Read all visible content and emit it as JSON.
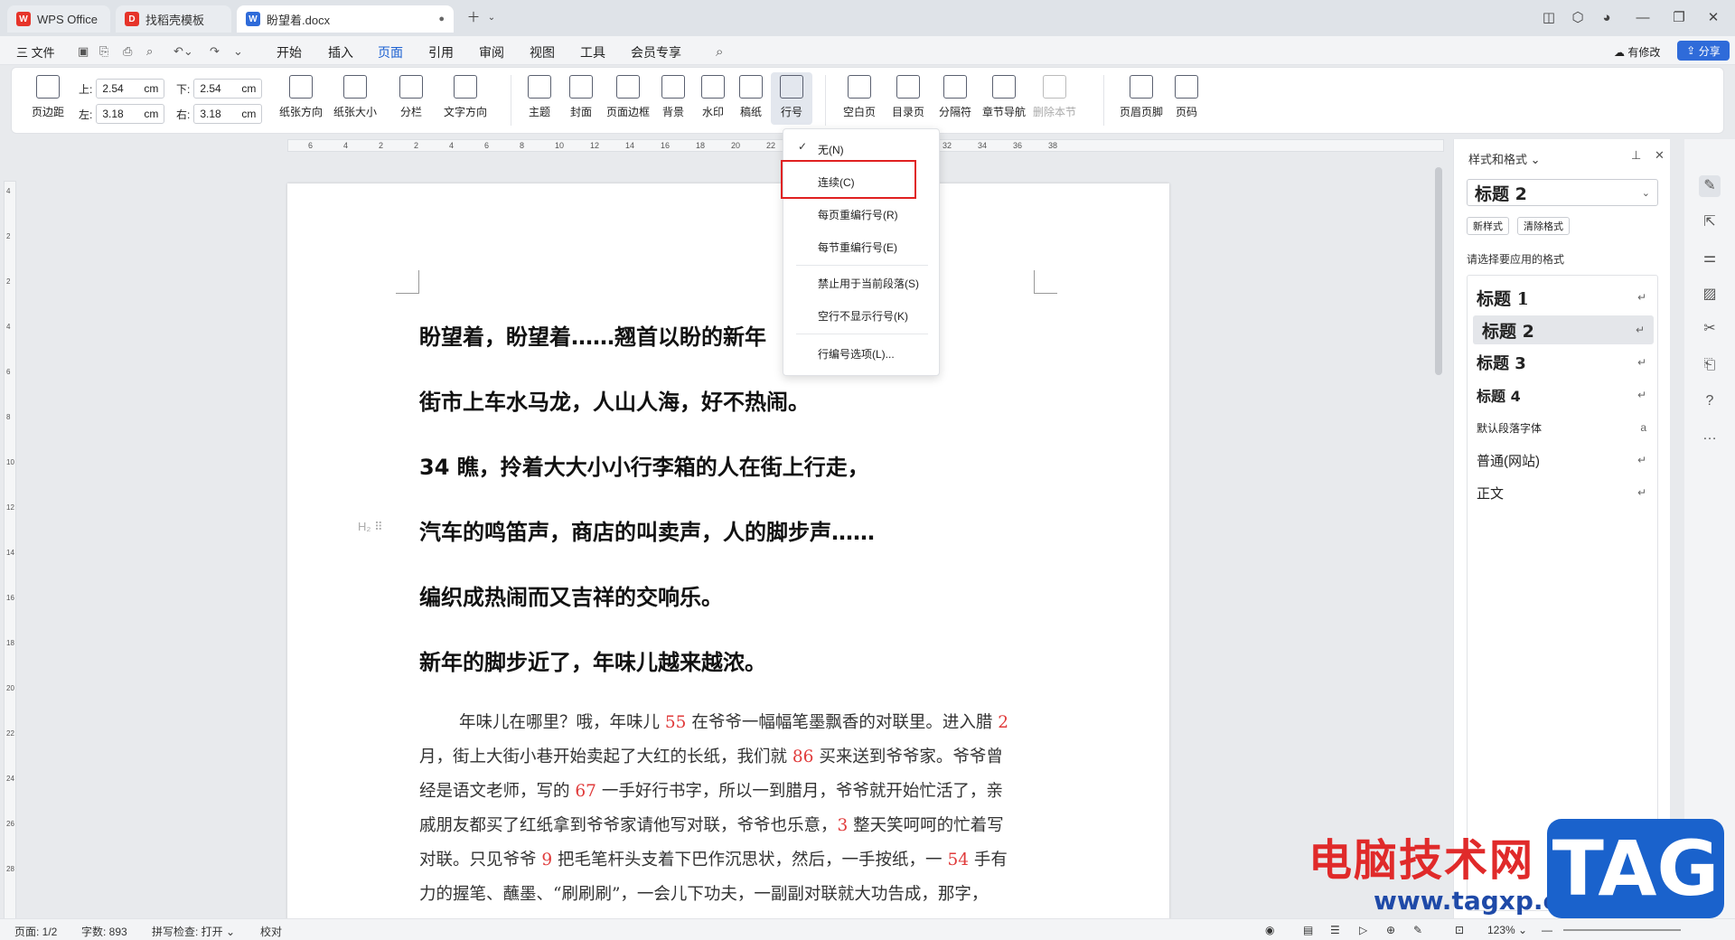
{
  "tabs": [
    {
      "label": "WPS Office",
      "logo": "W",
      "color": "#e6342a"
    },
    {
      "label": "找稻壳模板",
      "logo": "D",
      "color": "#e6342a"
    },
    {
      "label": "盼望着.docx",
      "logo": "W",
      "color": "#2f6bd9"
    }
  ],
  "menubar": {
    "file": "三 文件",
    "items": [
      "开始",
      "插入",
      "页面",
      "引用",
      "审阅",
      "视图",
      "工具",
      "会员专享"
    ],
    "active": "页面",
    "has_changes": "有修改",
    "share": "分享"
  },
  "ribbon": {
    "margins_label": "页边距",
    "top_label": "上:",
    "top_value": "2.54",
    "bottom_label": "下:",
    "bottom_value": "2.54",
    "left_label": "左:",
    "left_value": "3.18",
    "right_label": "右:",
    "right_value": "3.18",
    "unit": "cm",
    "buttons": [
      "纸张方向",
      "纸张大小",
      "分栏",
      "文字方向",
      "主题",
      "封面",
      "页面边框",
      "背景",
      "水印",
      "稿纸",
      "行号",
      "空白页",
      "目录页",
      "分隔符",
      "章节导航",
      "删除本节",
      "页眉页脚",
      "页码"
    ]
  },
  "ruler_ticks": [
    "6",
    "4",
    "2",
    "2",
    "4",
    "6",
    "8",
    "10",
    "12",
    "14",
    "16",
    "18",
    "20",
    "22",
    "24",
    "26",
    "28",
    "30",
    "32",
    "34",
    "36",
    "38"
  ],
  "vruler_ticks": [
    "4",
    "2",
    "2",
    "4",
    "6",
    "8",
    "10",
    "12",
    "14",
    "16",
    "18",
    "20",
    "22",
    "24",
    "26",
    "28"
  ],
  "dropdown": {
    "items": [
      "无(N)",
      "连续(C)",
      "每页重编行号(R)",
      "每节重编行号(E)",
      "禁止用于当前段落(S)",
      "空行不显示行号(K)",
      "行编号选项(L)..."
    ],
    "checked": "无(N)"
  },
  "document": {
    "headings": [
      "盼望着，盼望着……翘首以盼的新年",
      "街市上车水马龙，人山人海，好不热闹。",
      "34 瞧，拎着大大小小行李箱的人在街上行走，",
      "汽车的鸣笛声，商店的叫卖声，人的脚步声……",
      "编织成热闹而又吉祥的交响乐。",
      "新年的脚步近了，年味儿越来越浓。"
    ],
    "heading_marker": "H₂",
    "body": [
      [
        "年味儿在哪里？哦，年味儿 ",
        "55",
        " 在爷爷一幅幅笔墨飘香的对联里。进入腊 ",
        "2"
      ],
      [
        "月，街上大街小巷开始卖起了大红的长纸，我们就 ",
        "86",
        " 买来送到爷爷家。爷爷曾",
        ""
      ],
      [
        "经是语文老师，写的 ",
        "67",
        " 一手好行书字，所以一到腊月，爷爷就开始忙活了，亲",
        ""
      ],
      [
        "戚朋友都买了红纸拿到爷爷家请他写对联，爷爷也乐意，",
        "3",
        " 整天笑呵呵的忙着写",
        ""
      ],
      [
        "对联。只见爷爷 ",
        "9",
        " 把毛笔杆头支着下巴作沉思状，然后，一手按纸，一 ",
        "54"
      ],
      [
        "力的握笔、蘸墨、“刷刷刷”，一会儿下功夫，一副副对联就大功告成，那字，",
        "",
        "",
        ""
      ]
    ],
    "body_line5_tail": " 手有"
  },
  "style_pane": {
    "title": "样式和格式",
    "current_style": "标题 2",
    "new_style": "新样式",
    "clear_format": "清除格式",
    "hint": "请选择要应用的格式",
    "styles": [
      "标题 1",
      "标题 2",
      "标题 3",
      "标题 4",
      "默认段落字体",
      "普通(网站)",
      "正文"
    ],
    "selected": "标题 2"
  },
  "statusbar": {
    "page": "页面: 1/2",
    "words": "字数: 893",
    "spell": "拼写检查: 打开",
    "proof": "校对",
    "zoom": "123%"
  },
  "watermark": {
    "text": "电脑技术网",
    "url": "www.tagxp.com",
    "tag": "TAG"
  }
}
